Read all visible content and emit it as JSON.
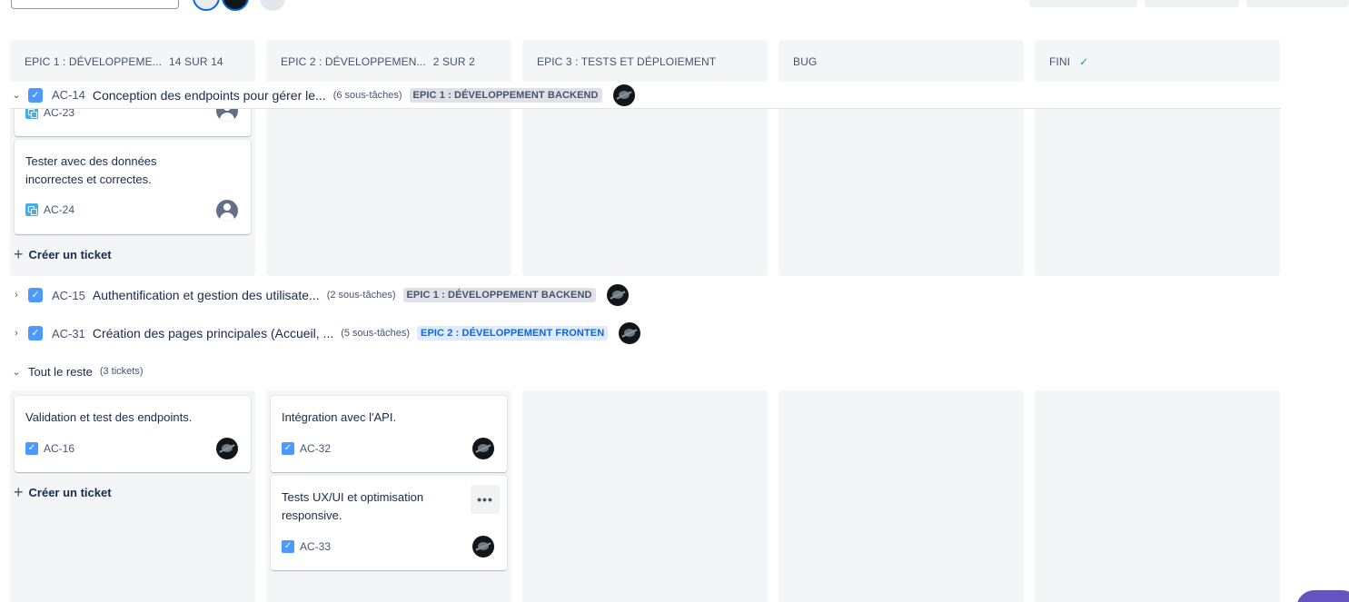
{
  "columns": [
    {
      "title": "EPIC 1 : DÉVELOPPEME...",
      "count": "14 SUR 14"
    },
    {
      "title": "EPIC 2 : DÉVELOPPEMEN...",
      "count": "2 SUR 2"
    },
    {
      "title": "EPIC 3 : TESTS ET DÉPLOIEMENT",
      "count": ""
    },
    {
      "title": "BUG",
      "count": ""
    },
    {
      "title": "FINI",
      "count": "",
      "done_icon": "checkmark-icon"
    }
  ],
  "swimlanes": [
    {
      "key": "AC-14",
      "title": "Conception des endpoints pour gérer le...",
      "subtasks": "(6 sous-tâches)",
      "epic": "EPIC 1 : DÉVELOPPEMENT BACKEND",
      "epic_color": "#dfe1e6",
      "expanded": true
    },
    {
      "key": "AC-15",
      "title": "Authentification et gestion des utilisate...",
      "subtasks": "(2 sous-tâches)",
      "epic": "EPIC 1 : DÉVELOPPEMENT BACKEND",
      "epic_color": "#dfe1e6",
      "expanded": false
    },
    {
      "key": "AC-31",
      "title": "Création des pages principales (Accueil, ...",
      "subtasks": "(5 sous-tâches)",
      "epic": "EPIC 2 : DÉVELOPPEMENT FRONTEN",
      "epic_color": "#deebff",
      "expanded": false
    }
  ],
  "lane1_cards": [
    {
      "key": "AC-23",
      "title": "",
      "type": "subtask-icon",
      "assignee": "unassigned"
    },
    {
      "key": "AC-24",
      "title": "Tester avec des données incorrectes et correctes.",
      "type": "subtask-icon",
      "assignee": "unassigned"
    }
  ],
  "rest_group": {
    "label": "Tout le reste",
    "count": "(3 tickets)"
  },
  "rest_cards": [
    {
      "key": "AC-16",
      "title": "Validation et test des endpoints.",
      "type": "task-icon"
    },
    {
      "key": "AC-32",
      "title": "Intégration avec l'API.",
      "type": "task-icon"
    },
    {
      "key": "AC-33",
      "title": "Tests UX/UI et optimisation responsive.",
      "type": "task-icon",
      "more": "•••"
    }
  ],
  "create_label": "Créer un ticket",
  "colors": {
    "accent": "#0c66e4",
    "checkbox": "#4c9aff",
    "column_bg": "#f4f5f7",
    "done": "#22a06b"
  }
}
